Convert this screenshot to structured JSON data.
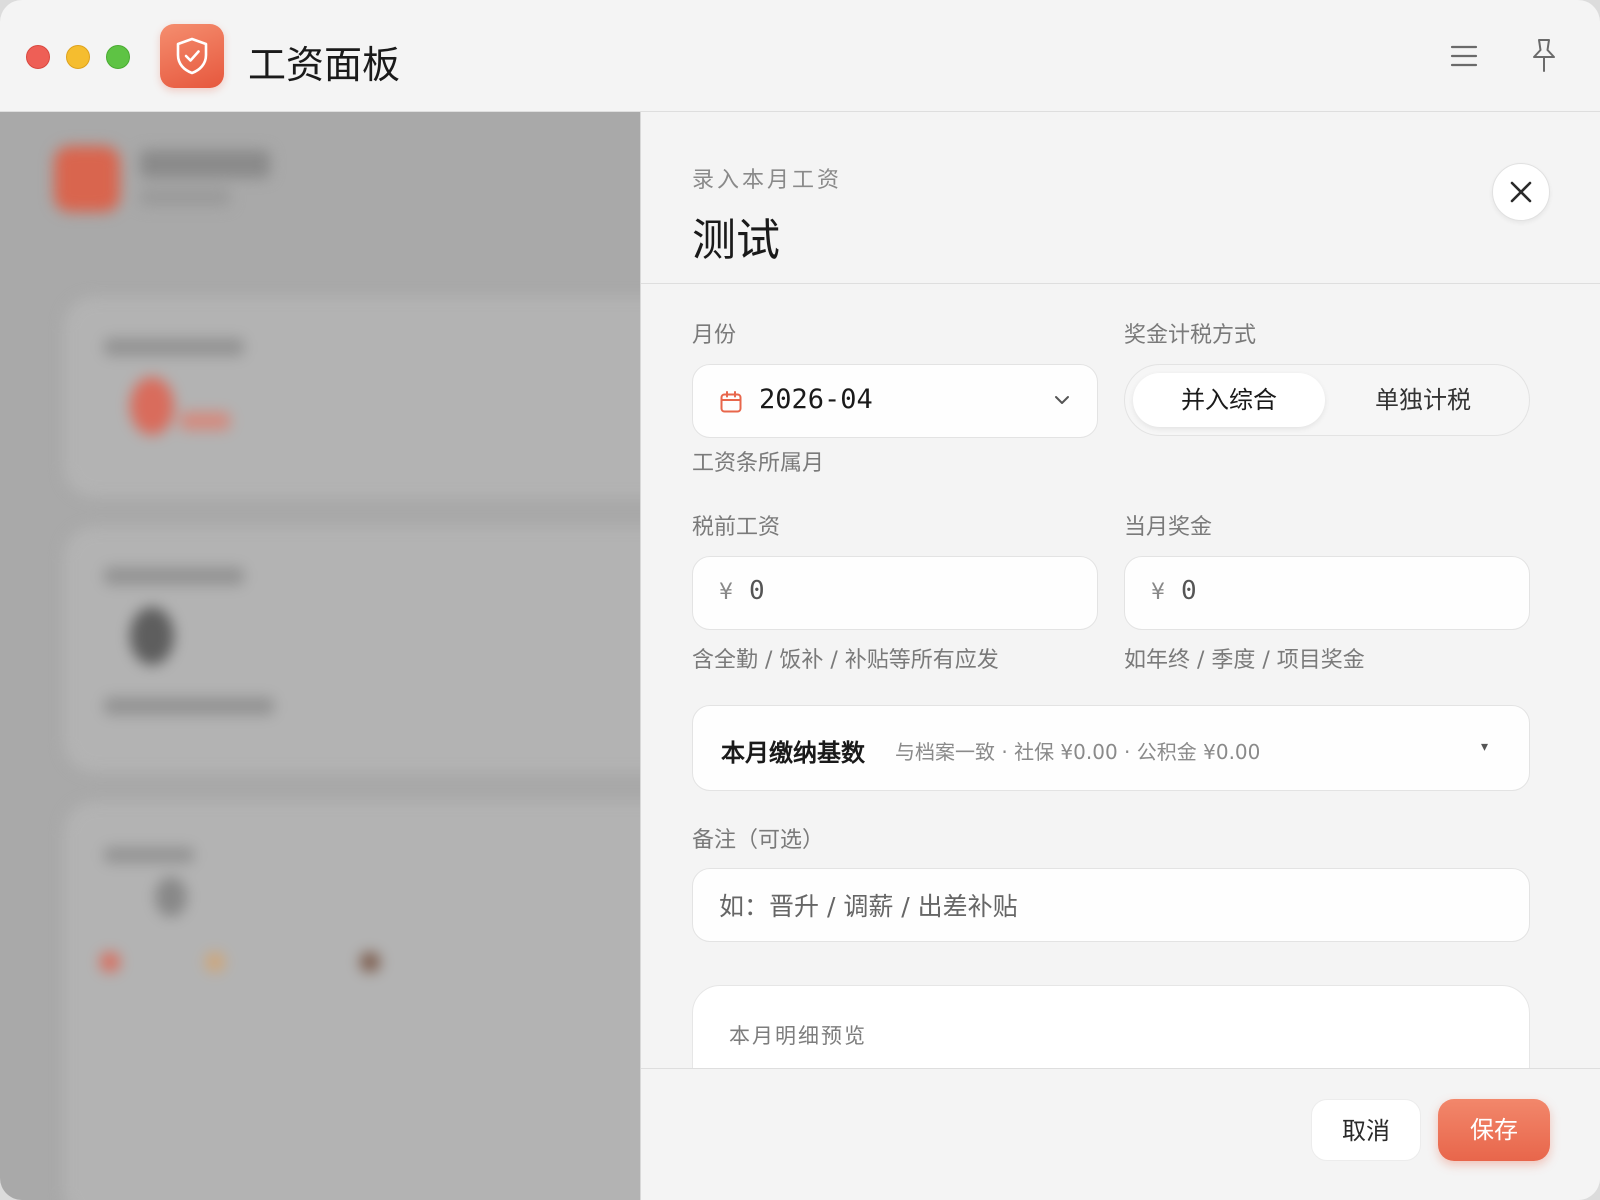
{
  "window": {
    "title": "工资面板",
    "brand_color": "#e8664b"
  },
  "icons": {
    "app": "shield-check-icon",
    "menu": "hamburger-menu-icon",
    "pin": "pin-icon",
    "close": "close-icon",
    "calendar": "calendar-icon",
    "dropdown": "chevron-down-icon"
  },
  "drawer": {
    "eyebrow": "录入本月工资",
    "title": "测试",
    "month": {
      "label": "月份",
      "value": "2026-04",
      "hint": "工资条所属月"
    },
    "bonus_tax": {
      "label": "奖金计税方式",
      "options": [
        "并入综合",
        "单独计税"
      ],
      "selected": "并入综合"
    },
    "salary": {
      "label": "税前工资",
      "currency": "¥",
      "value": "0",
      "hint": "含全勤 / 饭补 / 补贴等所有应发"
    },
    "bonus": {
      "label": "当月奖金",
      "currency": "¥",
      "value": "0",
      "hint": "如年终 / 季度 / 项目奖金"
    },
    "contribution_base": {
      "title": "本月缴纳基数",
      "description": "与档案一致 · 社保 ¥0.00 · 公积金 ¥0.00",
      "caret": "▾"
    },
    "note": {
      "label": "备注（可选）",
      "placeholder": "如：晋升 / 调薪 / 出差补贴"
    },
    "preview": {
      "title": "本月明细预览"
    },
    "actions": {
      "cancel": "取消",
      "save": "保存"
    }
  }
}
